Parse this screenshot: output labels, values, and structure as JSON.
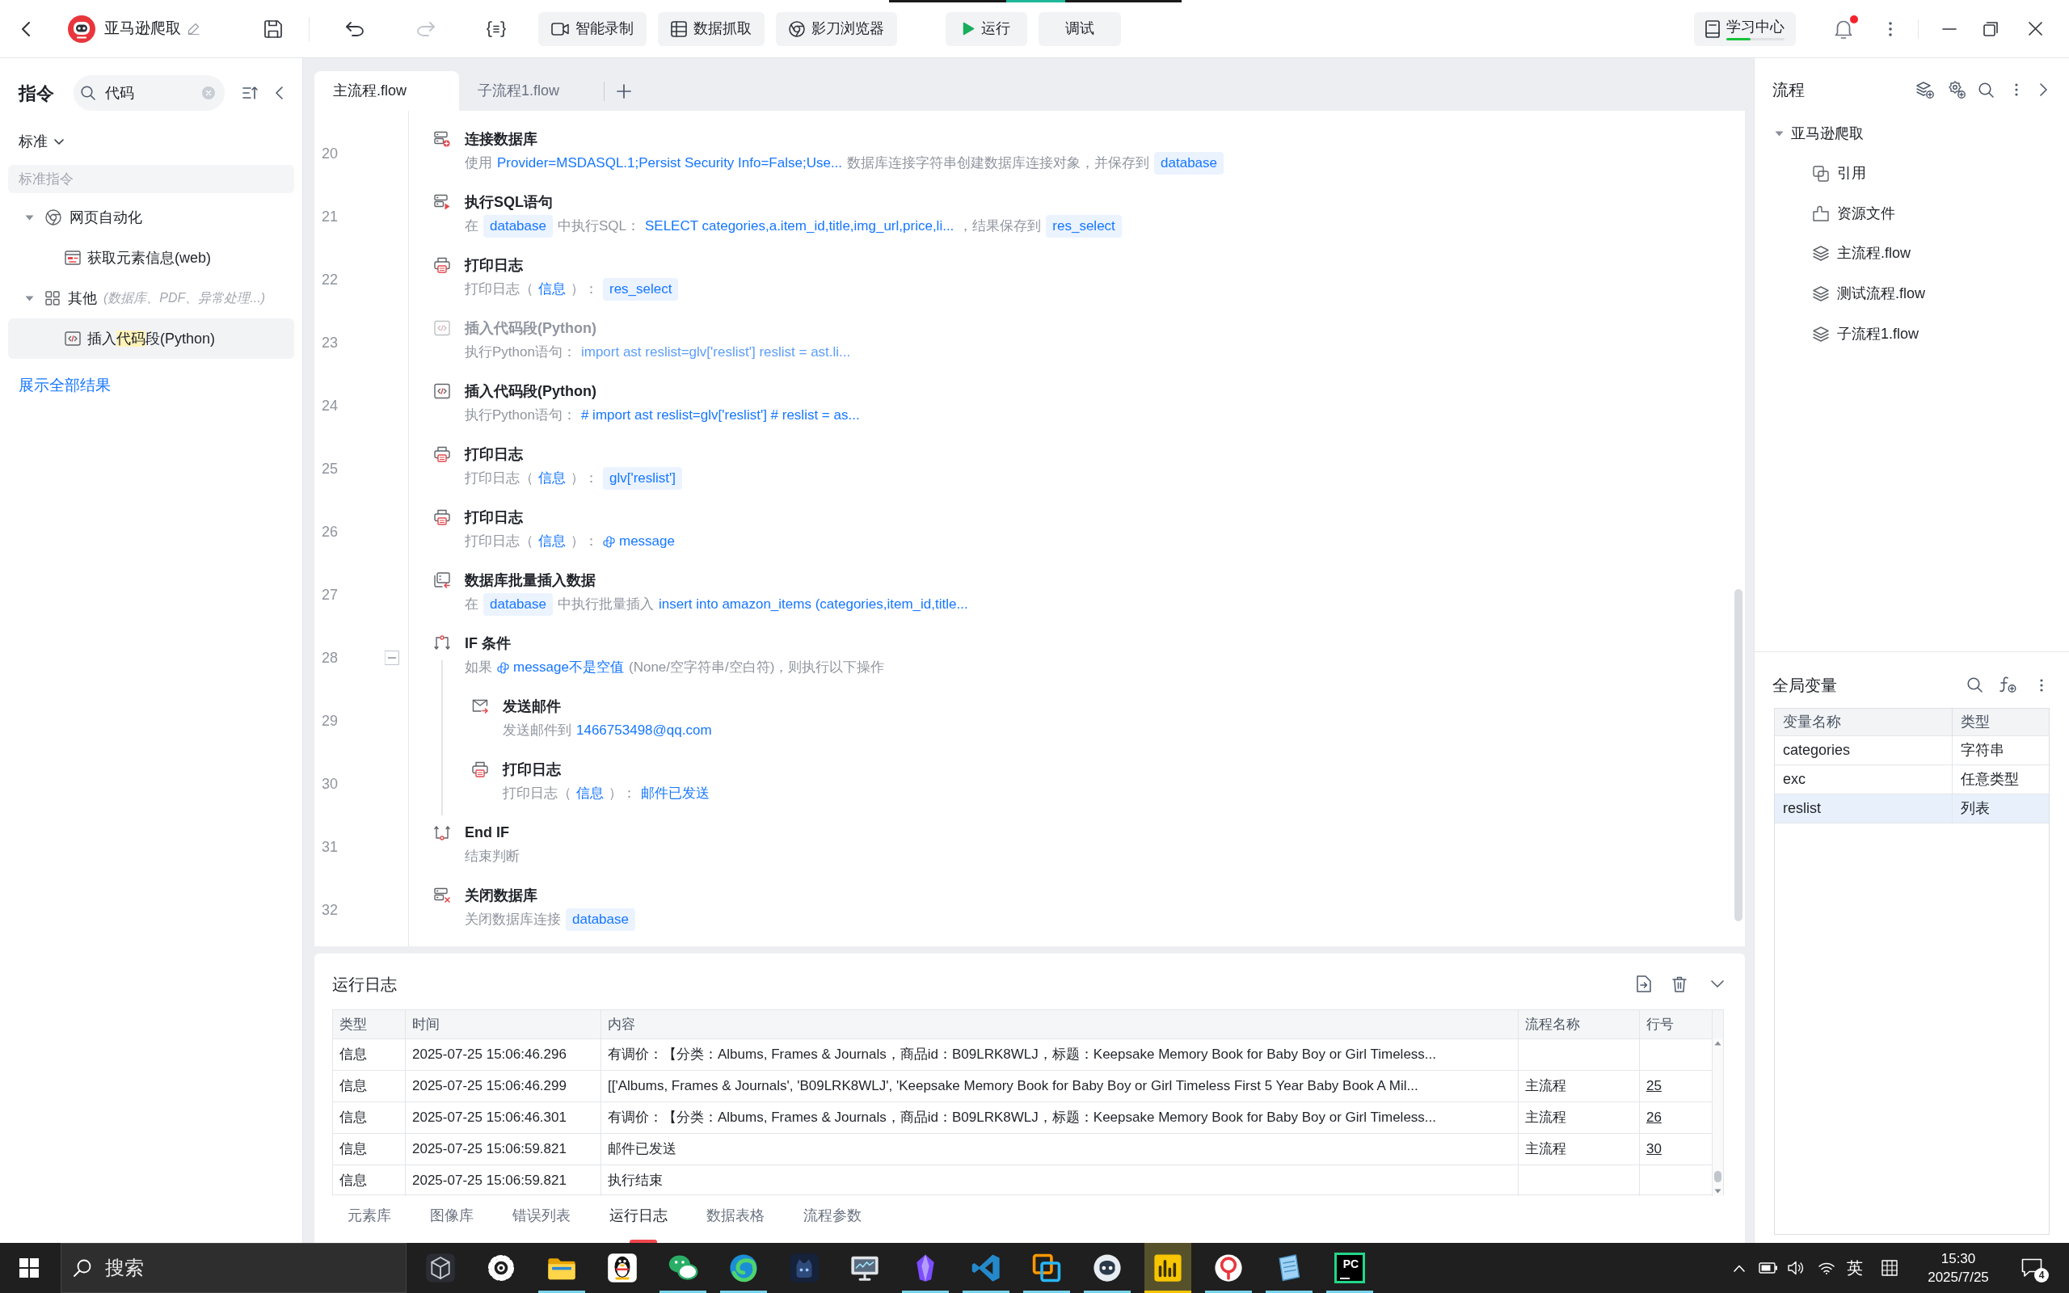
{
  "title_bar": {
    "project": "亚马逊爬取",
    "undo_disabled": false,
    "redo_disabled": true,
    "tool_buttons": [
      {
        "kind": "record",
        "label": "智能录制"
      },
      {
        "kind": "grab",
        "label": "数据抓取"
      },
      {
        "kind": "browser",
        "label": "影刀浏览器"
      }
    ],
    "run_button": "运行",
    "debug_button": "调试",
    "learning_center": {
      "label": "学习中心",
      "level": 0.42
    },
    "notifications_unread": true
  },
  "sidebar": {
    "title": "指令",
    "search": {
      "value": "代码"
    },
    "category": "标准",
    "section": "标准指令",
    "tree": [
      {
        "kind": "web",
        "label": "网页自动化",
        "expanded": true,
        "children": [
          {
            "kind": "web-element",
            "label_parts": [
              {
                "text": "获取元素信息(web)",
                "highlighted": false
              }
            ],
            "selected": false
          }
        ]
      },
      {
        "kind": "other",
        "label": "其他",
        "note": "(数据库、PDF、异常处理...)",
        "expanded": true,
        "children": [
          {
            "kind": "code",
            "label_parts": [
              {
                "text": "插入",
                "highlighted": false
              },
              {
                "text": "代码",
                "highlighted": true
              },
              {
                "text": "段(Python)",
                "highlighted": false
              }
            ],
            "selected": true
          }
        ]
      }
    ],
    "show_all_link": "展示全部结果"
  },
  "editor": {
    "tabs": [
      {
        "label": "主流程.flow",
        "selected": true
      },
      {
        "label": "子流程1.flow",
        "selected": false
      }
    ],
    "steps": [
      {
        "line": "20",
        "kind": "db-connect",
        "title": "连接数据库",
        "disabled": false,
        "description": [
          {
            "kind": "text",
            "text": "使用"
          },
          {
            "kind": "value",
            "text": "Provider=MSDASQL.1;Persist Security Info=False;Use..."
          },
          {
            "kind": "text",
            "text": "数据库连接字符串创建数据库连接对象，并保存到"
          },
          {
            "kind": "chip",
            "text": "database"
          }
        ]
      },
      {
        "line": "21",
        "kind": "db-sql",
        "title": "执行SQL语句",
        "disabled": false,
        "description": [
          {
            "kind": "text",
            "text": "在"
          },
          {
            "kind": "chip",
            "text": "database"
          },
          {
            "kind": "text",
            "text": "中执行SQL："
          },
          {
            "kind": "value",
            "text": "SELECT categories,a.item_id,title,img_url,price,li..."
          },
          {
            "kind": "text",
            "text": "，结果保存到"
          },
          {
            "kind": "chip",
            "text": "res_select"
          }
        ]
      },
      {
        "line": "22",
        "kind": "print",
        "title": "打印日志",
        "disabled": false,
        "description": [
          {
            "kind": "text",
            "text": "打印日志（"
          },
          {
            "kind": "value",
            "text": "信息"
          },
          {
            "kind": "text",
            "text": "）："
          },
          {
            "kind": "chip",
            "text": "res_select"
          }
        ]
      },
      {
        "line": "23",
        "kind": "code",
        "title": "插入代码段(Python)",
        "disabled": true,
        "description": [
          {
            "kind": "text",
            "text": "执行Python语句："
          },
          {
            "kind": "value",
            "text": "import ast reslist=glv['reslist'] reslist = ast.li..."
          }
        ]
      },
      {
        "line": "24",
        "kind": "code",
        "title": "插入代码段(Python)",
        "disabled": false,
        "description": [
          {
            "kind": "text",
            "text": "执行Python语句："
          },
          {
            "kind": "value",
            "text": "# import ast reslist=glv['reslist'] # reslist = as..."
          }
        ]
      },
      {
        "line": "25",
        "kind": "print",
        "title": "打印日志",
        "disabled": false,
        "description": [
          {
            "kind": "text",
            "text": "打印日志（"
          },
          {
            "kind": "value",
            "text": "信息"
          },
          {
            "kind": "text",
            "text": "）："
          },
          {
            "kind": "chip",
            "text": "glv['reslist']"
          }
        ]
      },
      {
        "line": "26",
        "kind": "print",
        "title": "打印日志",
        "disabled": false,
        "description": [
          {
            "kind": "text",
            "text": "打印日志（"
          },
          {
            "kind": "value",
            "text": "信息"
          },
          {
            "kind": "text",
            "text": "）："
          },
          {
            "kind": "pyvar",
            "text": "message"
          }
        ]
      },
      {
        "line": "27",
        "kind": "db-bulk",
        "title": "数据库批量插入数据",
        "disabled": false,
        "description": [
          {
            "kind": "text",
            "text": "在"
          },
          {
            "kind": "chip",
            "text": "database"
          },
          {
            "kind": "text",
            "text": "中执行批量插入"
          },
          {
            "kind": "value",
            "text": "insert into amazon_items (categories,item_id,title..."
          }
        ]
      },
      {
        "line": "28",
        "kind": "if",
        "title": "IF 条件",
        "disabled": false,
        "expanded": true,
        "description": [
          {
            "kind": "text",
            "text": "如果"
          },
          {
            "kind": "pyvar",
            "text": "message不是空值"
          },
          {
            "kind": "text",
            "text": "(None/空字符串/空白符)，则执行以下操作"
          }
        ],
        "children": [
          {
            "line": "29",
            "kind": "email",
            "title": "发送邮件",
            "disabled": false,
            "description": [
              {
                "kind": "text",
                "text": "发送邮件到"
              },
              {
                "kind": "value",
                "text": "1466753498@qq.com"
              }
            ]
          },
          {
            "line": "30",
            "kind": "print",
            "title": "打印日志",
            "disabled": false,
            "description": [
              {
                "kind": "text",
                "text": "打印日志（"
              },
              {
                "kind": "value",
                "text": "信息"
              },
              {
                "kind": "text",
                "text": "）："
              },
              {
                "kind": "value",
                "text": "邮件已发送"
              }
            ]
          }
        ]
      },
      {
        "line": "31",
        "kind": "end-if",
        "title": "End IF",
        "disabled": false,
        "description": [
          {
            "kind": "text",
            "text": "结束判断"
          }
        ]
      },
      {
        "line": "32",
        "kind": "db-close",
        "title": "关闭数据库",
        "disabled": false,
        "description": [
          {
            "kind": "text",
            "text": "关闭数据库连接"
          },
          {
            "kind": "chip",
            "text": "database"
          }
        ]
      }
    ]
  },
  "log_panel": {
    "title": "运行日志",
    "columns": [
      "类型",
      "时间",
      "内容",
      "流程名称",
      "行号"
    ],
    "rows": [
      {
        "type": "信息",
        "time": "2025-07-25 15:06:46.296",
        "content": "有调价：【分类：Albums, Frames & Journals，商品id：B09LRK8WLJ，标题：Keepsake Memory Book for Baby Boy or Girl Timeless..."
      },
      {
        "type": "信息",
        "time": "2025-07-25 15:06:46.299",
        "content": "[['Albums, Frames & Journals', 'B09LRK8WLJ', 'Keepsake Memory Book for Baby Boy or Girl Timeless First 5 Year Baby Book A Mil...",
        "flow": "主流程",
        "line": "25"
      },
      {
        "type": "信息",
        "time": "2025-07-25 15:06:46.301",
        "content": "有调价：【分类：Albums, Frames & Journals，商品id：B09LRK8WLJ，标题：Keepsake Memory Book for Baby Boy or Girl Timeless...",
        "flow": "主流程",
        "line": "26"
      },
      {
        "type": "信息",
        "time": "2025-07-25 15:06:59.821",
        "content": "邮件已发送",
        "flow": "主流程",
        "line": "30"
      },
      {
        "type": "信息",
        "time": "2025-07-25 15:06:59.821",
        "content": "执行结束"
      }
    ],
    "tabs": [
      {
        "label": "元素库",
        "selected": false
      },
      {
        "label": "图像库",
        "selected": false
      },
      {
        "label": "错误列表",
        "selected": false
      },
      {
        "label": "运行日志",
        "selected": true
      },
      {
        "label": "数据表格",
        "selected": false
      },
      {
        "label": "流程参数",
        "selected": false
      }
    ]
  },
  "flow_panel": {
    "title": "流程",
    "tree": {
      "label": "亚马逊爬取",
      "expanded": true,
      "children": [
        {
          "kind": "reference",
          "label": "引用"
        },
        {
          "kind": "resources",
          "label": "资源文件"
        },
        {
          "kind": "flow",
          "label": "主流程.flow"
        },
        {
          "kind": "flow",
          "label": "测试流程.flow"
        },
        {
          "kind": "flow",
          "label": "子流程1.flow"
        }
      ]
    }
  },
  "global_variables": {
    "title": "全局变量",
    "columns": [
      "变量名称",
      "类型"
    ],
    "rows": [
      {
        "name": "categories",
        "type": "字符串",
        "selected": false
      },
      {
        "name": "exc",
        "type": "任意类型",
        "selected": false
      },
      {
        "name": "reslist",
        "type": "列表",
        "selected": true
      }
    ]
  },
  "taskbar": {
    "search": {
      "placeholder": "搜索"
    },
    "apps": [
      {
        "kind": "cube",
        "running": false,
        "active": false
      },
      {
        "kind": "settings",
        "running": false,
        "active": false
      },
      {
        "kind": "folder",
        "running": true,
        "active": false
      },
      {
        "kind": "penguin",
        "running": false,
        "active": false
      },
      {
        "kind": "chat",
        "running": true,
        "active": false
      },
      {
        "kind": "swirl",
        "running": true,
        "active": false
      },
      {
        "kind": "cat",
        "running": false,
        "active": false
      },
      {
        "kind": "monitor",
        "running": false,
        "active": false
      },
      {
        "kind": "crystal",
        "running": true,
        "active": false
      },
      {
        "kind": "ribbon",
        "running": true,
        "active": false
      },
      {
        "kind": "squares",
        "running": true,
        "active": false
      },
      {
        "kind": "mascot",
        "running": true,
        "active": false
      },
      {
        "kind": "chart",
        "running": true,
        "active": true
      },
      {
        "kind": "emblem",
        "running": true,
        "active": false
      },
      {
        "kind": "notepad",
        "running": true,
        "active": false
      },
      {
        "kind": "tile",
        "logo_text": "PC",
        "running": true,
        "active": false
      }
    ],
    "ime": "英",
    "time": "15:30",
    "date": "2025/7/25",
    "notification_count": "4"
  }
}
